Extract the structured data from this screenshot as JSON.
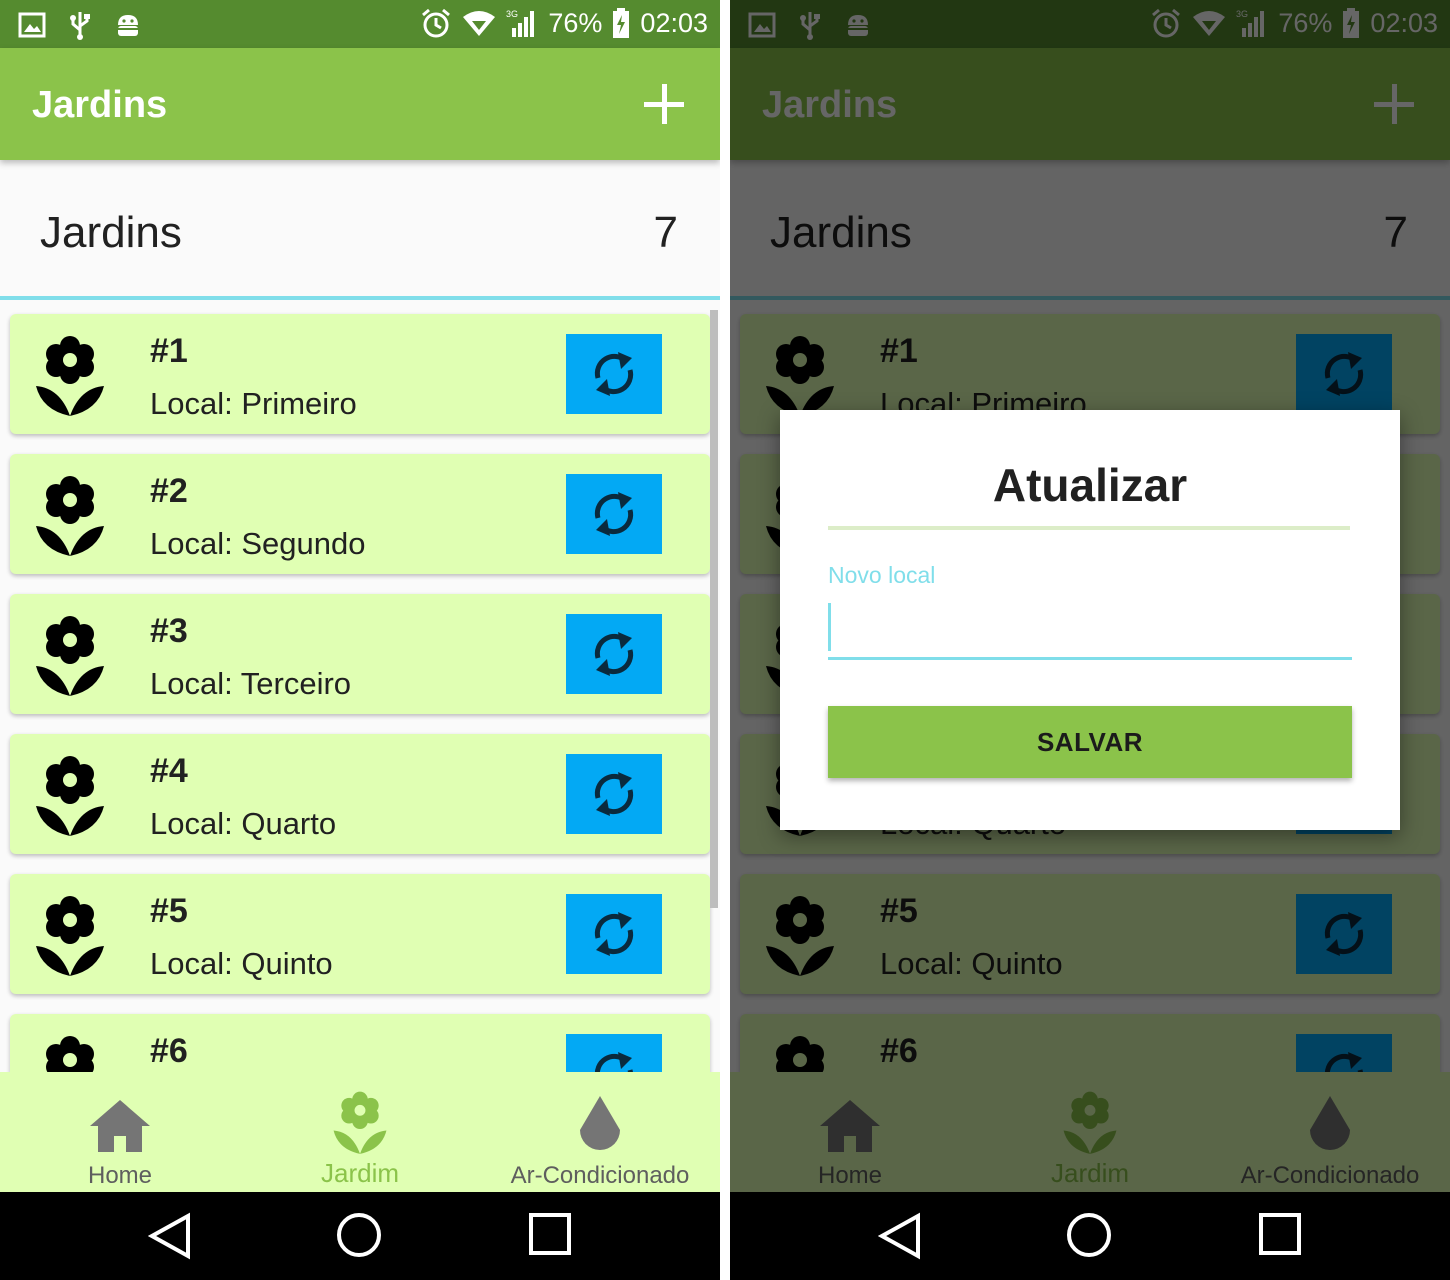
{
  "status_bar": {
    "battery": "76%",
    "time": "02:03",
    "network": "3G"
  },
  "app_bar": {
    "title": "Jardins",
    "add_icon": "plus-icon"
  },
  "header": {
    "title": "Jardins",
    "count": "7"
  },
  "gardens": [
    {
      "num": "#1",
      "local": "Local: Primeiro"
    },
    {
      "num": "#2",
      "local": "Local: Segundo"
    },
    {
      "num": "#3",
      "local": "Local: Terceiro"
    },
    {
      "num": "#4",
      "local": "Local: Quarto"
    },
    {
      "num": "#5",
      "local": "Local: Quinto"
    },
    {
      "num": "#6",
      "local": ""
    }
  ],
  "bottom_nav": [
    {
      "label": "Home",
      "icon": "home-icon",
      "active": false
    },
    {
      "label": "Jardim",
      "icon": "flower-icon",
      "active": true
    },
    {
      "label": "Ar-Condicionado",
      "icon": "drop-icon",
      "active": false
    }
  ],
  "dialog": {
    "title": "Atualizar",
    "input_label": "Novo local",
    "input_value": "",
    "save_label": "SALVAR"
  },
  "colors": {
    "primary": "#8bc34a",
    "primary_dark": "#558b2f",
    "card_bg": "#e0ffb3",
    "refresh_bg": "#03a9f4",
    "accent": "#80deea"
  }
}
